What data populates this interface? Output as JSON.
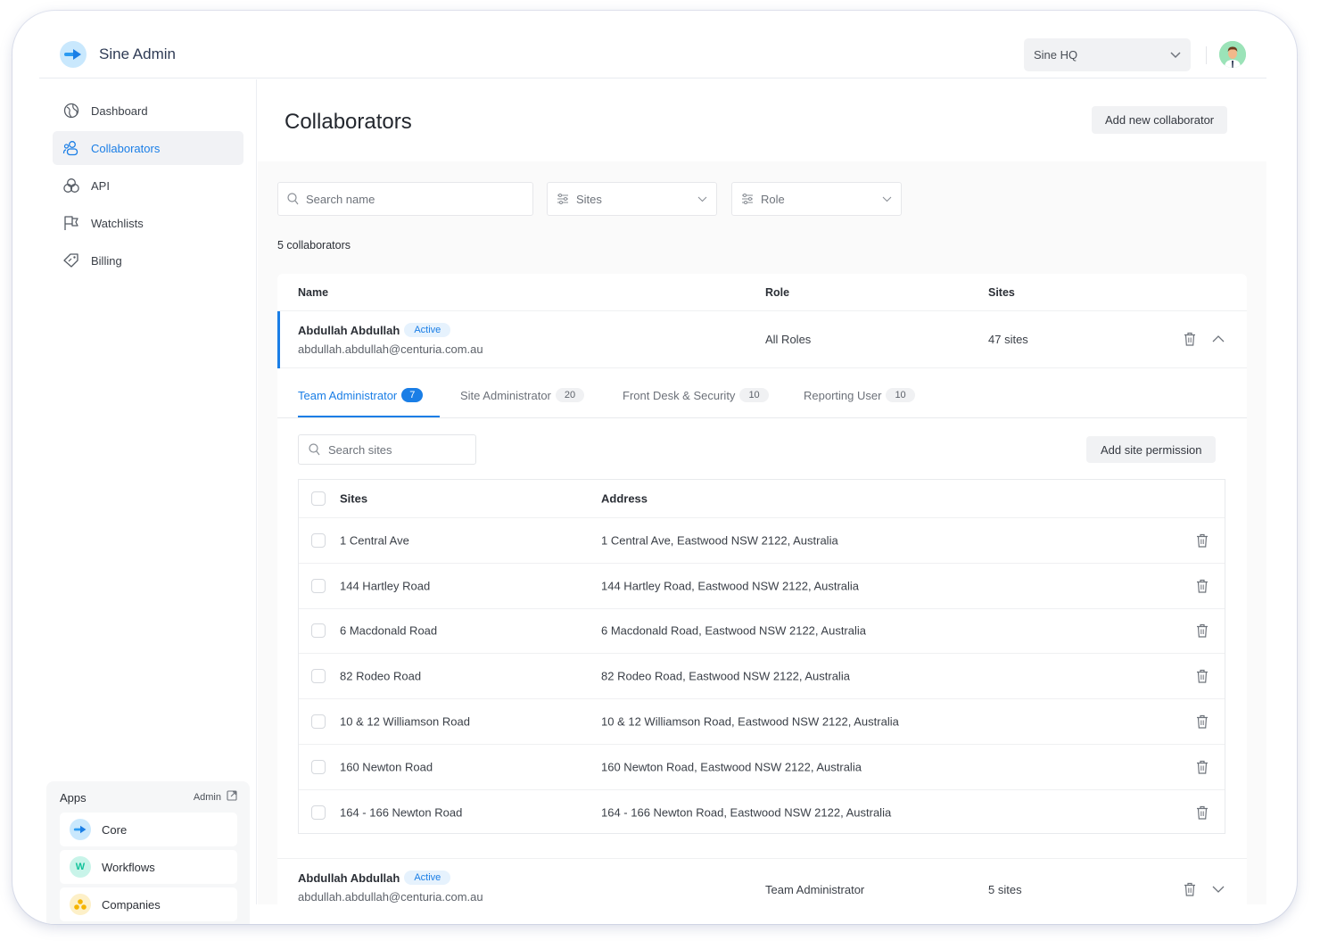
{
  "app": {
    "name": "Sine Admin",
    "site_selector": "Sine HQ"
  },
  "sidebar": {
    "items": [
      {
        "label": "Dashboard",
        "icon": "globe-icon",
        "active": false
      },
      {
        "label": "Collaborators",
        "icon": "users-icon",
        "active": true
      },
      {
        "label": "API",
        "icon": "circles-icon",
        "active": false
      },
      {
        "label": "Watchlists",
        "icon": "flag-icon",
        "active": false
      },
      {
        "label": "Billing",
        "icon": "tag-icon",
        "active": false
      }
    ],
    "apps": {
      "title": "Apps",
      "admin_link": "Admin",
      "items": [
        {
          "label": "Core",
          "icon": "sine-arrow-icon"
        },
        {
          "label": "Workflows",
          "icon": "workflows-w-icon"
        },
        {
          "label": "Companies",
          "icon": "companies-triangle-icon"
        }
      ]
    }
  },
  "main": {
    "title": "Collaborators",
    "add_button": "Add new collaborator",
    "filters": {
      "search_placeholder": "Search name",
      "sites_label": "Sites",
      "role_label": "Role"
    },
    "count_text": "5 collaborators",
    "columns": [
      "Name",
      "Role",
      "Sites"
    ],
    "collaborators": [
      {
        "name": "Abdullah Abdullah",
        "status": "Active",
        "email": "abdullah.abdullah@centuria.com.au",
        "role": "All Roles",
        "sites": "47 sites",
        "expanded": true
      },
      {
        "name": "Abdullah Abdullah",
        "status": "Active",
        "email": "abdullah.abdullah@centuria.com.au",
        "role": "Team Administrator",
        "sites": "5 sites",
        "expanded": false
      }
    ],
    "detail": {
      "tabs": [
        {
          "label": "Team Administrator",
          "count": "7",
          "active": true
        },
        {
          "label": "Site Administrator",
          "count": "20",
          "active": false
        },
        {
          "label": "Front Desk & Security",
          "count": "10",
          "active": false
        },
        {
          "label": "Reporting User",
          "count": "10",
          "active": false
        }
      ],
      "search_placeholder": "Search sites",
      "add_button": "Add site permission",
      "columns": [
        "Sites",
        "Address"
      ],
      "rows": [
        {
          "site": "1 Central Ave",
          "address": "1 Central Ave, Eastwood NSW 2122, Australia"
        },
        {
          "site": "144 Hartley Road",
          "address": "144 Hartley Road, Eastwood NSW 2122, Australia"
        },
        {
          "site": "6 Macdonald Road",
          "address": "6 Macdonald Road, Eastwood NSW 2122, Australia"
        },
        {
          "site": "82 Rodeo Road",
          "address": "82 Rodeo Road, Eastwood NSW 2122, Australia"
        },
        {
          "site": "10 & 12 Williamson Road",
          "address": "10 & 12 Williamson Road, Eastwood NSW 2122, Australia"
        },
        {
          "site": "160 Newton Road",
          "address": "160 Newton Road, Eastwood NSW 2122, Australia"
        },
        {
          "site": "164 - 166 Newton Road",
          "address": "164 - 166 Newton Road, Eastwood NSW 2122, Australia"
        }
      ]
    }
  },
  "colors": {
    "accent": "#1a7ee6",
    "badge_bg": "#e6f2fd",
    "button_bg": "#f1f2f4"
  }
}
